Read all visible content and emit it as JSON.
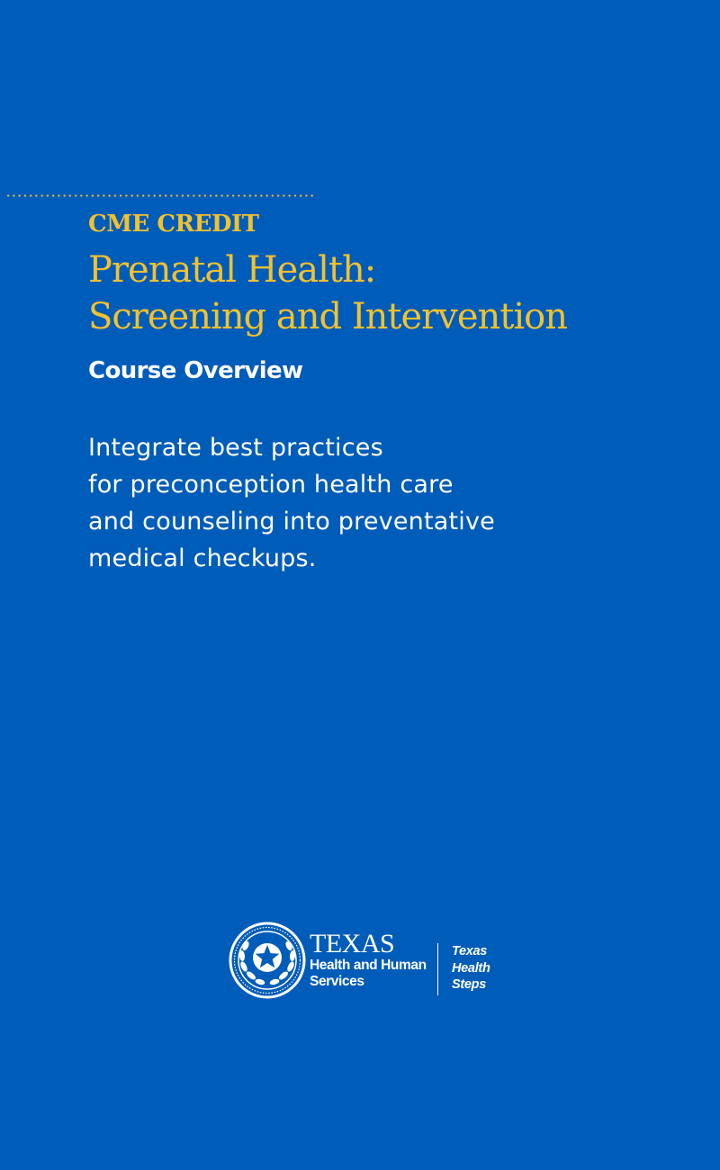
{
  "header": {
    "eyebrow": "CME CREDIT",
    "title_lines": [
      "Prenatal Health:",
      "Screening and Intervention"
    ],
    "subtitle": "Course Overview"
  },
  "overview": {
    "lines": [
      "Integrate best practices",
      "for preconception health care",
      "and counseling into preventative",
      "medical checkups."
    ]
  },
  "logo": {
    "org_name": "TEXAS",
    "org_sub_lines": [
      "Health and Human",
      "Services"
    ],
    "program_lines": [
      "Texas",
      "Health",
      "Steps"
    ],
    "seal_icon": "texas-star-seal-icon"
  },
  "colors": {
    "background": "#005cb9",
    "accent": "#f2c12e",
    "text": "#ffffff"
  }
}
